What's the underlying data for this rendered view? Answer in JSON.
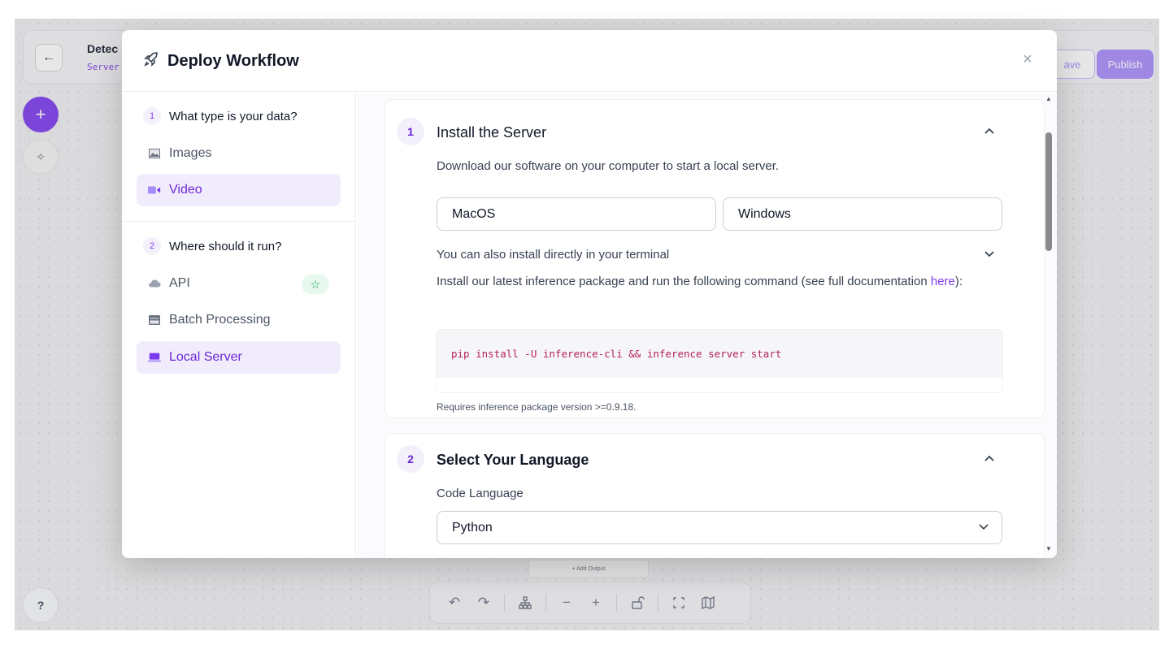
{
  "background": {
    "workflow_title": "Detec",
    "workflow_subtitle": "Server",
    "save_label": "ave",
    "publish_label": "Publish",
    "add_label": "+",
    "help_label": "?",
    "add_output_label": "+ Add Output"
  },
  "modal": {
    "title": "Deploy Workflow",
    "close_label": "×"
  },
  "sidebar": {
    "step1": {
      "number": "1",
      "label": "What type is your data?"
    },
    "data_types": [
      {
        "label": "Images",
        "icon": "image-icon",
        "active": false
      },
      {
        "label": "Video",
        "icon": "video-camera-icon",
        "active": true
      }
    ],
    "step2": {
      "number": "2",
      "label": "Where should it run?"
    },
    "targets": [
      {
        "label": "API",
        "icon": "cloud-icon",
        "active": false,
        "badge": "star-icon"
      },
      {
        "label": "Batch Processing",
        "icon": "server-rack-icon",
        "active": false
      },
      {
        "label": "Local Server",
        "icon": "laptop-icon",
        "active": true
      }
    ]
  },
  "install": {
    "number": "1",
    "title": "Install the Server",
    "description": "Download our software on your computer to start a local server.",
    "os_buttons": [
      "MacOS",
      "Windows"
    ],
    "terminal_toggle": "You can also install directly in your terminal",
    "terminal_desc_before": "Install our latest inference package and run the following command (see full documentation ",
    "terminal_link": "here",
    "terminal_desc_after": "):",
    "command": "pip install -U inference-cli && inference server start",
    "requirement": "Requires inference package version >=0.9.18."
  },
  "language": {
    "number": "2",
    "title": "Select Your Language",
    "field_label": "Code Language",
    "selected": "Python"
  },
  "colors": {
    "accent": "#7c3aed",
    "accent_bg": "#f0ecfb",
    "code_text": "#b4235b",
    "badge_green": "#16a34a"
  }
}
